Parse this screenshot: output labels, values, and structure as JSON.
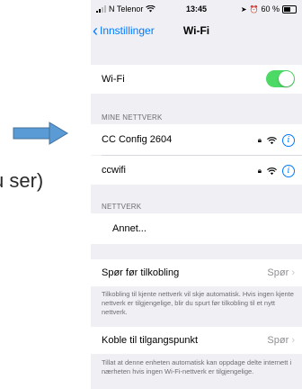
{
  "slide": {
    "partial_text": "u ser)"
  },
  "status_bar": {
    "carrier": "N Telenor",
    "time": "13:45",
    "battery": "60 %"
  },
  "nav": {
    "back_label": "Innstillinger",
    "title": "Wi-Fi"
  },
  "wifi_row": {
    "label": "Wi-Fi",
    "enabled": true
  },
  "my_networks": {
    "header": "MINE NETTVERK",
    "items": [
      {
        "name": "CC Config 2604"
      },
      {
        "name": "ccwifi"
      }
    ]
  },
  "networks": {
    "header": "NETTVERK",
    "other_label": "Annet..."
  },
  "ask_join": {
    "label": "Spør før tilkobling",
    "value": "Spør",
    "footer": "Tilkobling til kjente nettverk vil skje automatisk. Hvis ingen kjente nettverk er tilgjengelige, blir du spurt før tilkobling til et nytt nettverk."
  },
  "hotspot": {
    "label": "Koble til tilgangspunkt",
    "value": "Spør",
    "footer": "Tillat at denne enheten automatisk kan oppdage delte internett i nærheten hvis ingen Wi-Fi-nettverk er tilgjengelige."
  },
  "colors": {
    "accent": "#007aff",
    "toggle_on": "#4cd964",
    "arrow": "#5b9bd5"
  }
}
